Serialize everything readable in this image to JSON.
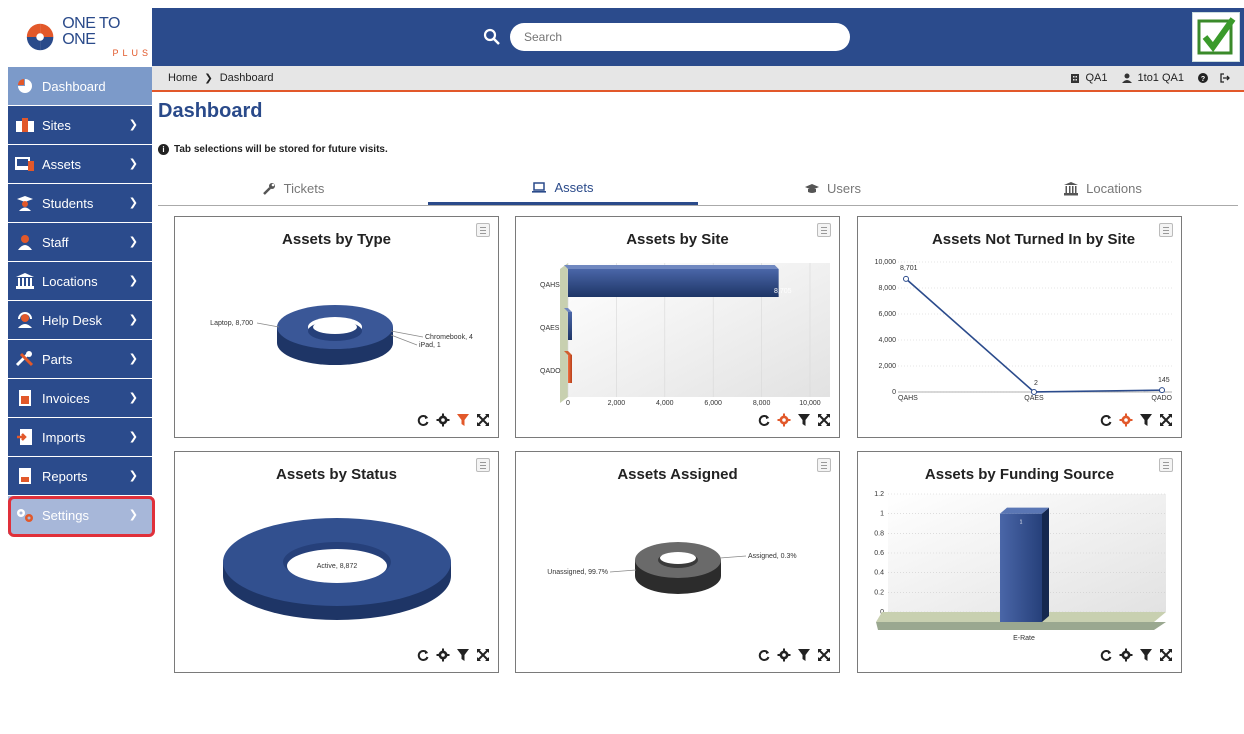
{
  "logo": {
    "main": "ONE TO ONE",
    "sub": "PLUS"
  },
  "sidebar": {
    "items": [
      {
        "label": "Dashboard",
        "icon": "pie-chart-icon"
      },
      {
        "label": "Sites",
        "icon": "building-icon"
      },
      {
        "label": "Assets",
        "icon": "devices-icon"
      },
      {
        "label": "Students",
        "icon": "student-icon"
      },
      {
        "label": "Staff",
        "icon": "person-icon"
      },
      {
        "label": "Locations",
        "icon": "institution-icon"
      },
      {
        "label": "Help Desk",
        "icon": "headset-icon"
      },
      {
        "label": "Parts",
        "icon": "tools-icon"
      },
      {
        "label": "Invoices",
        "icon": "invoice-icon"
      },
      {
        "label": "Imports",
        "icon": "import-icon"
      },
      {
        "label": "Reports",
        "icon": "report-icon"
      },
      {
        "label": "Settings",
        "icon": "gears-icon"
      }
    ]
  },
  "search": {
    "placeholder": "Search"
  },
  "breadcrumb": {
    "home": "Home",
    "current": "Dashboard"
  },
  "user": {
    "site": "QA1",
    "name": "1to1 QA1"
  },
  "page": {
    "title": "Dashboard",
    "notice": "Tab selections will be stored for future visits."
  },
  "tabs": [
    {
      "label": "Tickets",
      "icon": "wrench-icon"
    },
    {
      "label": "Assets",
      "icon": "laptop-icon",
      "active": true
    },
    {
      "label": "Users",
      "icon": "graduation-cap-icon"
    },
    {
      "label": "Locations",
      "icon": "institution-icon"
    }
  ],
  "colors": {
    "navy": "#2b4b8c",
    "accent": "#e2582a",
    "active_nav": "#7c9ac9",
    "highlight": "#e0303a"
  },
  "chart_data": [
    {
      "type": "pie",
      "title": "Assets by Type",
      "categories": [
        "Laptop",
        "Chromebook",
        "iPad"
      ],
      "values": [
        8700,
        4,
        1
      ],
      "data_labels": [
        "Laptop, 8,700",
        "Chromebook, 4",
        "iPad, 1"
      ]
    },
    {
      "type": "bar",
      "title": "Assets by Site",
      "orientation": "horizontal",
      "categories": [
        "QAHS",
        "QAES",
        "QADO"
      ],
      "values": [
        8705,
        2,
        145
      ],
      "data_labels": [
        "8,705"
      ],
      "xticks": [
        "0",
        "2,000",
        "4,000",
        "6,000",
        "8,000",
        "10,000"
      ],
      "xlim": [
        0,
        10000
      ]
    },
    {
      "type": "line",
      "title": "Assets Not Turned In by Site",
      "categories": [
        "QAHS",
        "QAES",
        "QADO"
      ],
      "values": [
        8701,
        2,
        145
      ],
      "data_labels": [
        "8,701",
        "2",
        "145"
      ],
      "yticks": [
        "0",
        "2,000",
        "4,000",
        "6,000",
        "8,000",
        "10,000"
      ],
      "ylim": [
        0,
        10000
      ]
    },
    {
      "type": "pie",
      "title": "Assets by Status",
      "categories": [
        "Active"
      ],
      "values": [
        8872
      ],
      "data_labels": [
        "Active, 8,872"
      ]
    },
    {
      "type": "pie",
      "title": "Assets Assigned",
      "categories": [
        "Unassigned",
        "Assigned"
      ],
      "values": [
        99.7,
        0.3
      ],
      "data_labels": [
        "Unassigned, 99.7%",
        "Assigned, 0.3%"
      ]
    },
    {
      "type": "bar",
      "title": "Assets by Funding Source",
      "categories": [
        "E-Rate"
      ],
      "values": [
        1
      ],
      "data_labels": [
        "1"
      ],
      "yticks": [
        "0",
        "0.2",
        "0.4",
        "0.6",
        "0.8",
        "1",
        "1.2"
      ],
      "ylim": [
        0,
        1.2
      ]
    }
  ]
}
